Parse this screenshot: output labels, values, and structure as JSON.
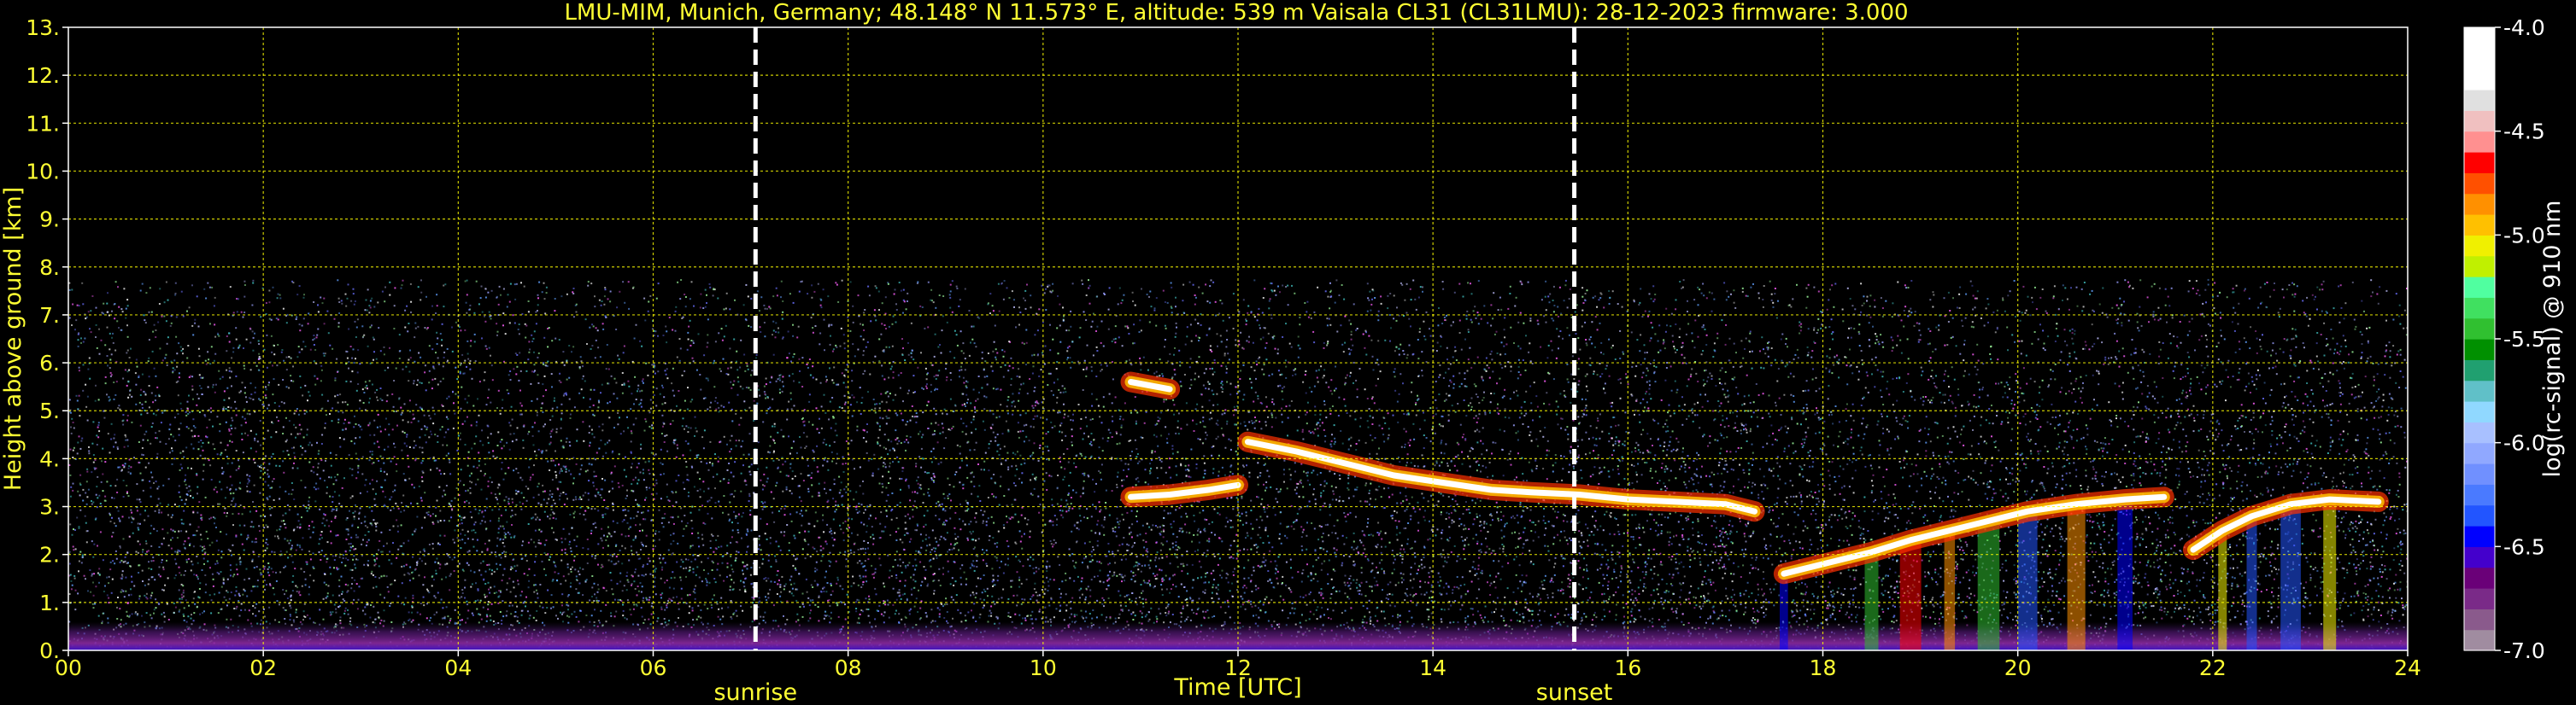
{
  "chart_data": {
    "type": "heatmap",
    "title": "LMU-MIM, Munich, Germany; 48.148° N 11.573° E, altitude: 539 m    Vaisala CL31 (CL31LMU): 28-12-2023    firmware: 3.000",
    "xlabel": "Time [UTC]",
    "ylabel": "Height above ground [km]",
    "xlim": [
      0,
      24
    ],
    "ylim": [
      0,
      13
    ],
    "x_ticks": [
      "00",
      "02",
      "04",
      "06",
      "08",
      "10",
      "12",
      "14",
      "16",
      "18",
      "20",
      "22",
      "24"
    ],
    "y_ticks": [
      "0.",
      "1.",
      "2.",
      "3.",
      "4.",
      "5.",
      "6.",
      "7.",
      "8.",
      "9.",
      "10.",
      "11.",
      "12.",
      "13."
    ],
    "grid": true,
    "colorbar": {
      "label": "log(rc-signal) @ 910 nm",
      "range": [
        -7.0,
        -4.0
      ],
      "ticks": [
        "-4.0",
        "-4.5",
        "-5.0",
        "-5.5",
        "-6.0",
        "-6.5",
        "-7.0"
      ],
      "colors": [
        "#a08ca0",
        "#8a5a8c",
        "#7a2a88",
        "#6a0078",
        "#4400cc",
        "#0000ff",
        "#2255ff",
        "#4a7aff",
        "#7090ff",
        "#90a8ff",
        "#a8c0ff",
        "#90d8ff",
        "#60c0c8",
        "#20a070",
        "#009000",
        "#30c030",
        "#40e060",
        "#50ffa0",
        "#c0f000",
        "#f0f000",
        "#ffc000",
        "#ff9000",
        "#ff5000",
        "#ff0000",
        "#ff9090",
        "#f0c0c0",
        "#e0e0e0",
        "#ffffff",
        "#ffffff",
        "#ffffff"
      ]
    },
    "events": [
      {
        "label": "sunrise",
        "x": 7.05
      },
      {
        "label": "sunset",
        "x": 15.45
      }
    ],
    "signal_top_km": 7.75,
    "cloud_layers": [
      {
        "points": [
          [
            10.9,
            3.2
          ],
          [
            11.3,
            3.25
          ],
          [
            11.7,
            3.35
          ],
          [
            12.0,
            3.45
          ]
        ]
      },
      {
        "points": [
          [
            10.9,
            5.6
          ],
          [
            11.3,
            5.45
          ]
        ]
      },
      {
        "points": [
          [
            12.1,
            4.35
          ],
          [
            12.6,
            4.15
          ],
          [
            13.1,
            3.9
          ],
          [
            13.6,
            3.65
          ],
          [
            14.1,
            3.5
          ],
          [
            14.6,
            3.35
          ],
          [
            15.0,
            3.3
          ],
          [
            15.5,
            3.25
          ],
          [
            16.0,
            3.15
          ],
          [
            16.5,
            3.1
          ],
          [
            17.0,
            3.05
          ],
          [
            17.3,
            2.9
          ]
        ]
      },
      {
        "points": [
          [
            17.6,
            1.6
          ],
          [
            18.1,
            1.85
          ],
          [
            18.5,
            2.05
          ],
          [
            18.9,
            2.3
          ],
          [
            19.3,
            2.5
          ],
          [
            19.7,
            2.7
          ],
          [
            20.1,
            2.9
          ],
          [
            20.6,
            3.05
          ],
          [
            21.1,
            3.15
          ],
          [
            21.5,
            3.2
          ]
        ]
      },
      {
        "points": [
          [
            21.8,
            2.1
          ],
          [
            22.1,
            2.5
          ],
          [
            22.4,
            2.8
          ],
          [
            22.8,
            3.05
          ],
          [
            23.2,
            3.15
          ],
          [
            23.7,
            3.1
          ]
        ]
      }
    ]
  }
}
